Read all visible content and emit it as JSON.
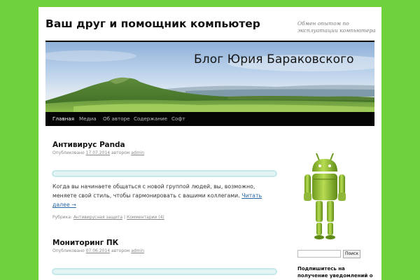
{
  "header": {
    "site_title": "Ваш друг и помощник компьютер",
    "site_description": "Обмен опытом по эксплуатации компьютера",
    "banner_text": "Блог Юрия Бараковского"
  },
  "nav": {
    "items": [
      {
        "label": "Главная",
        "active": true
      },
      {
        "label": "Медиа",
        "active": false
      },
      {
        "label": "Об авторе",
        "active": false
      },
      {
        "label": "Содержание",
        "active": false
      },
      {
        "label": "Софт",
        "active": false
      }
    ]
  },
  "posts": [
    {
      "title": "Антивирус Panda",
      "meta_published": "Опубликовано",
      "date": "17.07.2014",
      "meta_author": "автором",
      "author": "admin",
      "body": "Когда вы начинаете общаться с новой группой людей, вы, возможно, меняете свой стиль, чтобы гармонировать с вашими коллегами.",
      "read_more": "Читать далее →",
      "footer_category_label": "Рубрика:",
      "category": "Антивирусная защита",
      "separator": "|",
      "comments": "Комментарии (4)"
    },
    {
      "title": "Мониторинг ПК",
      "meta_published": "Опубликовано",
      "date": "07.06.2014",
      "meta_author": "автором",
      "author": "admin"
    }
  ],
  "sidebar": {
    "image_icon": "android-robot-icon",
    "search_placeholder": "",
    "search_button": "Поиск",
    "widget_title": "Подпишитесь на получение уведомлений о"
  },
  "colors": {
    "background": "#6fd13c",
    "nav_background": "#050505",
    "link": "#2866a6",
    "post_box": "#e3f4f5"
  }
}
